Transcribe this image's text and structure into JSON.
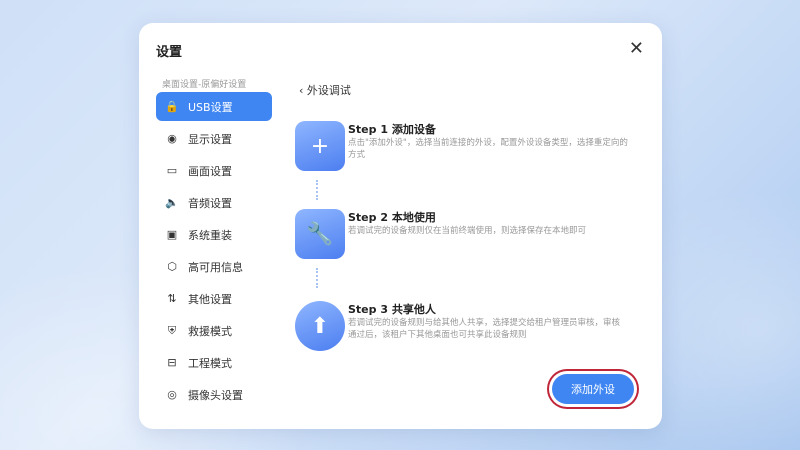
{
  "dialog": {
    "title": "设置",
    "close_icon": "close-icon"
  },
  "sidebar": {
    "breadcrumb": "桌面设置-原偏好设置",
    "items": [
      {
        "label": "USB设置",
        "icon": "🔒"
      },
      {
        "label": "显示设置",
        "icon": "◉"
      },
      {
        "label": "画面设置",
        "icon": "▭"
      },
      {
        "label": "音频设置",
        "icon": "🔈"
      },
      {
        "label": "系统重装",
        "icon": "▣"
      },
      {
        "label": "高可用信息",
        "icon": "⬡"
      },
      {
        "label": "其他设置",
        "icon": "⇅"
      },
      {
        "label": "救援模式",
        "icon": "⛨"
      },
      {
        "label": "工程模式",
        "icon": "⊟"
      },
      {
        "label": "摄像头设置",
        "icon": "◎"
      }
    ]
  },
  "main": {
    "back_label": "外设调试",
    "steps": [
      {
        "title": "Step 1 添加设备",
        "desc": "点击\"添加外设\"，选择当前连接的外设，配置外设设备类型，选择重定向的方式",
        "icon": "+"
      },
      {
        "title": "Step 2 本地使用",
        "desc": "若调试完的设备规则仅在当前终端使用，则选择保存在本地即可",
        "icon": "🔧"
      },
      {
        "title": "Step 3 共享他人",
        "desc": "若调试完的设备规则与给其他人共享，选择提交给租户管理员审核，审核通过后，该租户下其他桌面也可共享此设备规则",
        "icon": "⬆"
      }
    ],
    "add_button": "添加外设"
  },
  "colors": {
    "accent": "#3f86f2",
    "highlight": "#c0263a"
  }
}
